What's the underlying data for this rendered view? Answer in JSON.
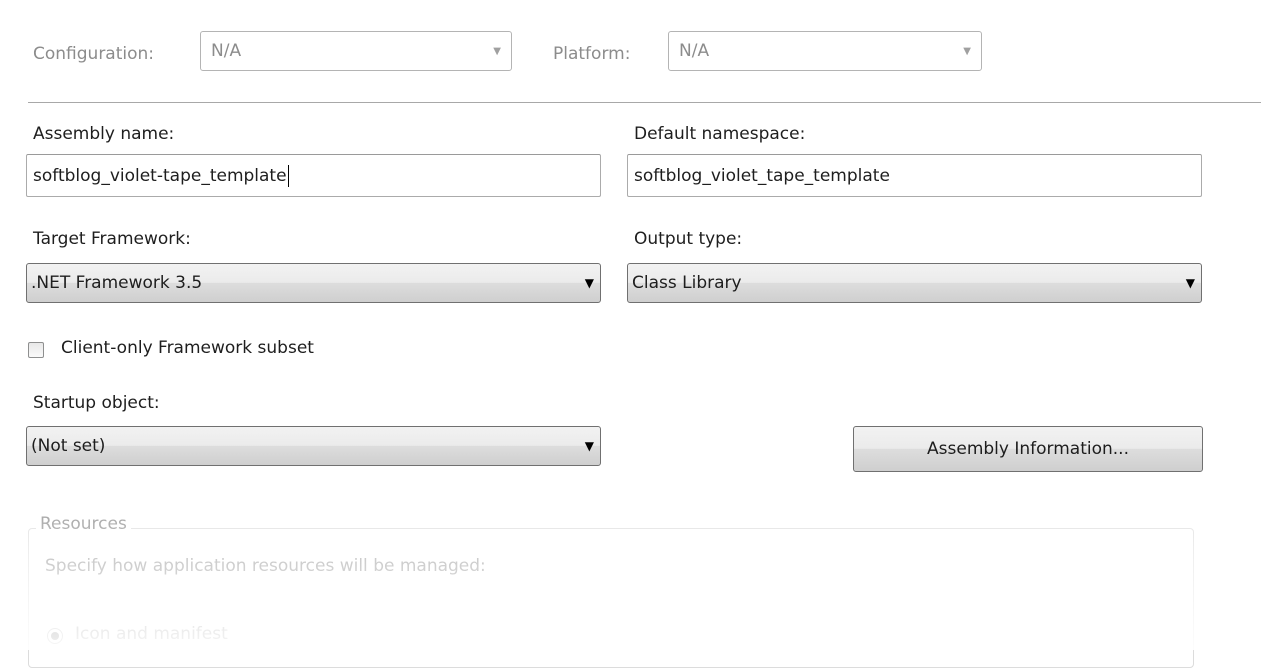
{
  "config_bar": {
    "configuration_label": "Configuration:",
    "configuration_value": "N/A",
    "platform_label": "Platform:",
    "platform_value": "N/A"
  },
  "assembly_name": {
    "label": "Assembly name:",
    "value": "softblog_violet-tape_template"
  },
  "default_namespace": {
    "label": "Default namespace:",
    "value": "softblog_violet_tape_template"
  },
  "target_framework": {
    "label": "Target Framework:",
    "value": ".NET Framework 3.5"
  },
  "output_type": {
    "label": "Output type:",
    "value": "Class Library"
  },
  "client_only": {
    "label": "Client-only Framework subset",
    "checked": false
  },
  "startup_object": {
    "label": "Startup object:",
    "value": "(Not set)"
  },
  "assembly_info_button": "Assembly Information...",
  "resources": {
    "title": "Resources",
    "description": "Specify how application resources will be managed:",
    "option_icon_manifest": "Icon and manifest"
  },
  "icons": {
    "dropdown_arrow": "triangle-down",
    "checkbox": "unchecked",
    "radio": "selected"
  }
}
